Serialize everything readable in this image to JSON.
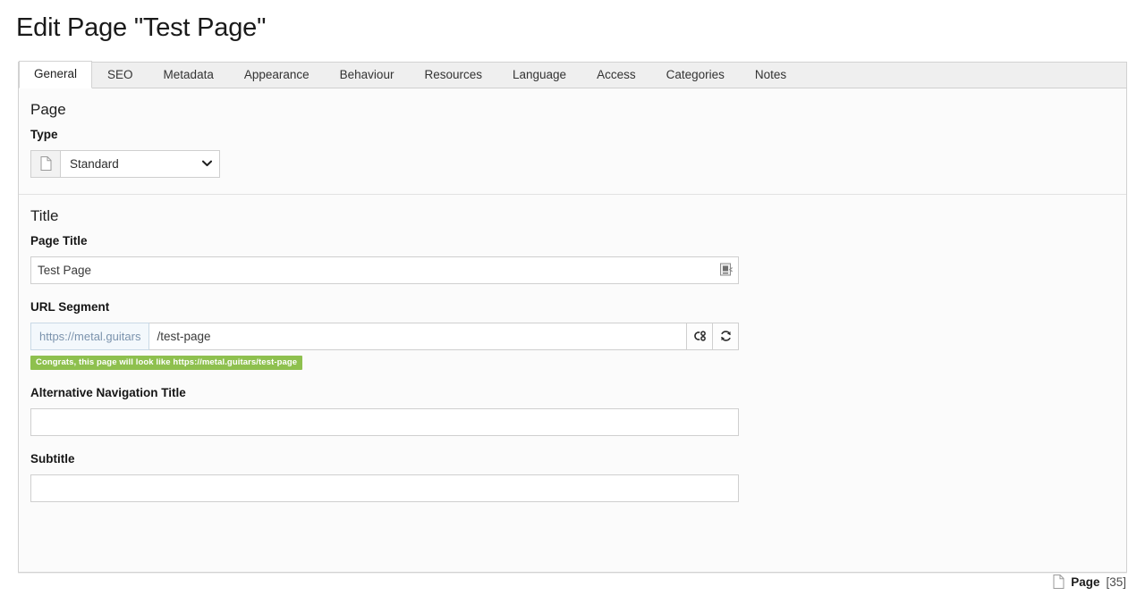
{
  "heading": "Edit Page \"Test Page\"",
  "tabs": [
    {
      "label": "General",
      "active": true
    },
    {
      "label": "SEO",
      "active": false
    },
    {
      "label": "Metadata",
      "active": false
    },
    {
      "label": "Appearance",
      "active": false
    },
    {
      "label": "Behaviour",
      "active": false
    },
    {
      "label": "Resources",
      "active": false
    },
    {
      "label": "Language",
      "active": false
    },
    {
      "label": "Access",
      "active": false
    },
    {
      "label": "Categories",
      "active": false
    },
    {
      "label": "Notes",
      "active": false
    }
  ],
  "sections": {
    "page": {
      "title": "Page",
      "type_label": "Type",
      "type_value": "Standard",
      "type_icon": "page-icon",
      "chevron_icon": "chevron-down-icon"
    },
    "title": {
      "title": "Title",
      "page_title_label": "Page Title",
      "page_title_value": "Test Page",
      "page_title_affix_icon": "resource-picker-icon",
      "url_segment_label": "URL Segment",
      "url_prefix": "https://metal.guitars",
      "url_segment_value": "/test-page",
      "url_preview_icon": "link-preview-icon",
      "url_refresh_icon": "refresh-icon",
      "url_hint": "Congrats, this page will look like https://metal.guitars/test-page",
      "alt_nav_label": "Alternative Navigation Title",
      "alt_nav_value": "",
      "subtitle_label": "Subtitle",
      "subtitle_value": ""
    }
  },
  "footer": {
    "icon": "page-icon",
    "label": "Page",
    "id": "[35]"
  },
  "colors": {
    "hint_green": "#8ec04e",
    "url_prefix_bg": "#f3f8fc",
    "url_prefix_text": "#7b93ad",
    "panel_bg": "#fbfbfb",
    "tab_strip_bg": "#efefef"
  }
}
